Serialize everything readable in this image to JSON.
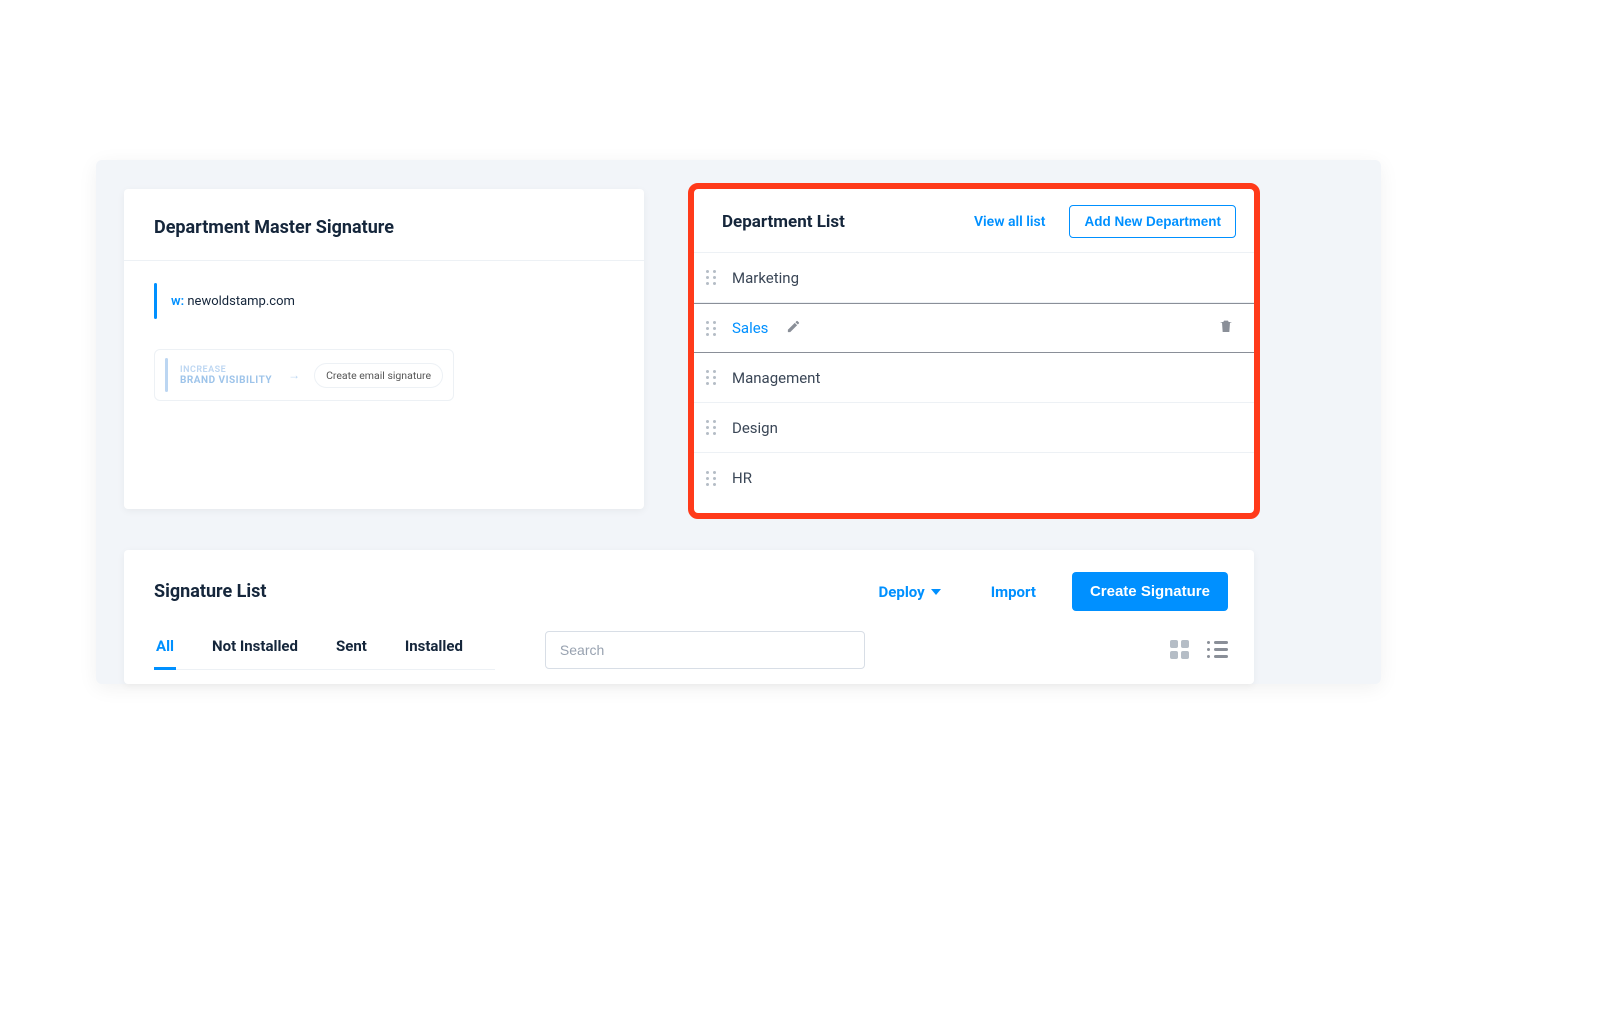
{
  "master": {
    "title": "Department Master Signature",
    "web_label": "w:",
    "web_value": "newoldstamp.com",
    "banner_line1": "INCREASE",
    "banner_line2": "BRAND VISIBILITY",
    "banner_cta": "Create email signature"
  },
  "dept": {
    "title": "Department List",
    "view_all": "View all list",
    "add_label": "Add New Department",
    "items": [
      {
        "name": "Marketing",
        "selected": false
      },
      {
        "name": "Sales",
        "selected": true
      },
      {
        "name": "Management",
        "selected": false
      },
      {
        "name": "Design",
        "selected": false
      },
      {
        "name": "HR",
        "selected": false
      }
    ]
  },
  "siglist": {
    "title": "Signature List",
    "deploy": "Deploy",
    "import": "Import",
    "create": "Create Signature",
    "tabs": [
      "All",
      "Not Installed",
      "Sent",
      "Installed"
    ],
    "active_tab": "All",
    "search_placeholder": "Search"
  }
}
